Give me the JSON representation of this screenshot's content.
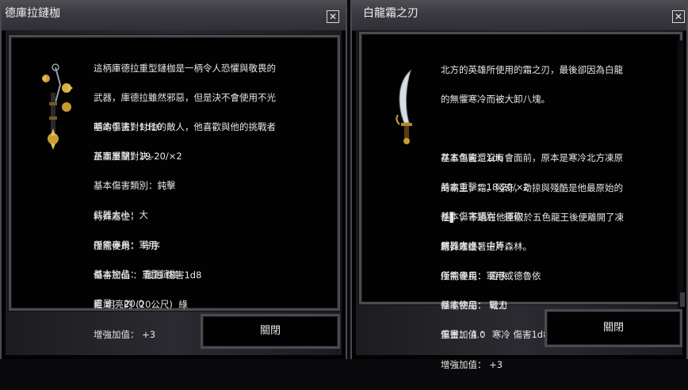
{
  "left_window": {
    "title": "德庫拉鏈枷",
    "close_icon": "close-icon",
    "icon": "flail-icon",
    "description_lines": [
      "這柄庫德拉重型鏈枷是一柄令人恐懼與敬畏的",
      "武器，庫德拉雖然邪惡，但是決不會使用不光",
      "明的手法對付他的敵人，他喜歡與他的挑戰者",
      "正面展開對決。"
    ],
    "stats_lines": [
      "基本傷害：1d10",
      "基本重擊：19-20/×2",
      "基本傷害類別：鈍擊",
      "武器大小：大",
      "所需專長：軍用",
      "基本物品： 重型鏈枷",
      "重量： 20.0"
    ],
    "props_lines": [
      "特殊屬性：",
      "僅能使用： 守序",
      "傷害加值 ： 酸蝕 傷害1d8",
      "輕 明亮的 (20公尺)  綠",
      "增強加值： +3"
    ],
    "close_label": "關閉"
  },
  "right_window": {
    "title": "白龍霜之刃",
    "close_icon": "close-icon",
    "icon": "scimitar-icon",
    "description_lines": [
      "北方的英雄所使用的霜之刃，最後卻因為白龍",
      "的無懼寒冷而被大卸八塊。",
      "",
      "在五色龍還沒有會面前，原本是寒冷北方凍原",
      "的霸主，霜。殘奇，劫掠與殘酷是他最原始的",
      "性▌ ，不過在他臣服於五色龍王後便離開了凍",
      "原，守護著這片森林。"
    ],
    "stats_lines": [
      "基本傷害：1d6",
      "基本重擊：18-20/×2",
      "基本傷害類別：揮砍",
      "武器大小：中等",
      "所需專長：軍用或德魯依",
      "基本物品： 彎刀",
      "重量： 4.0"
    ],
    "props_lines": [
      "特殊屬性：",
      "僅能使用： 遊俠",
      "僅能使用： 戰士",
      "傷害加值 ： 寒冷 傷害1d8",
      "增強加值： +3"
    ],
    "close_label": "關閉"
  }
}
